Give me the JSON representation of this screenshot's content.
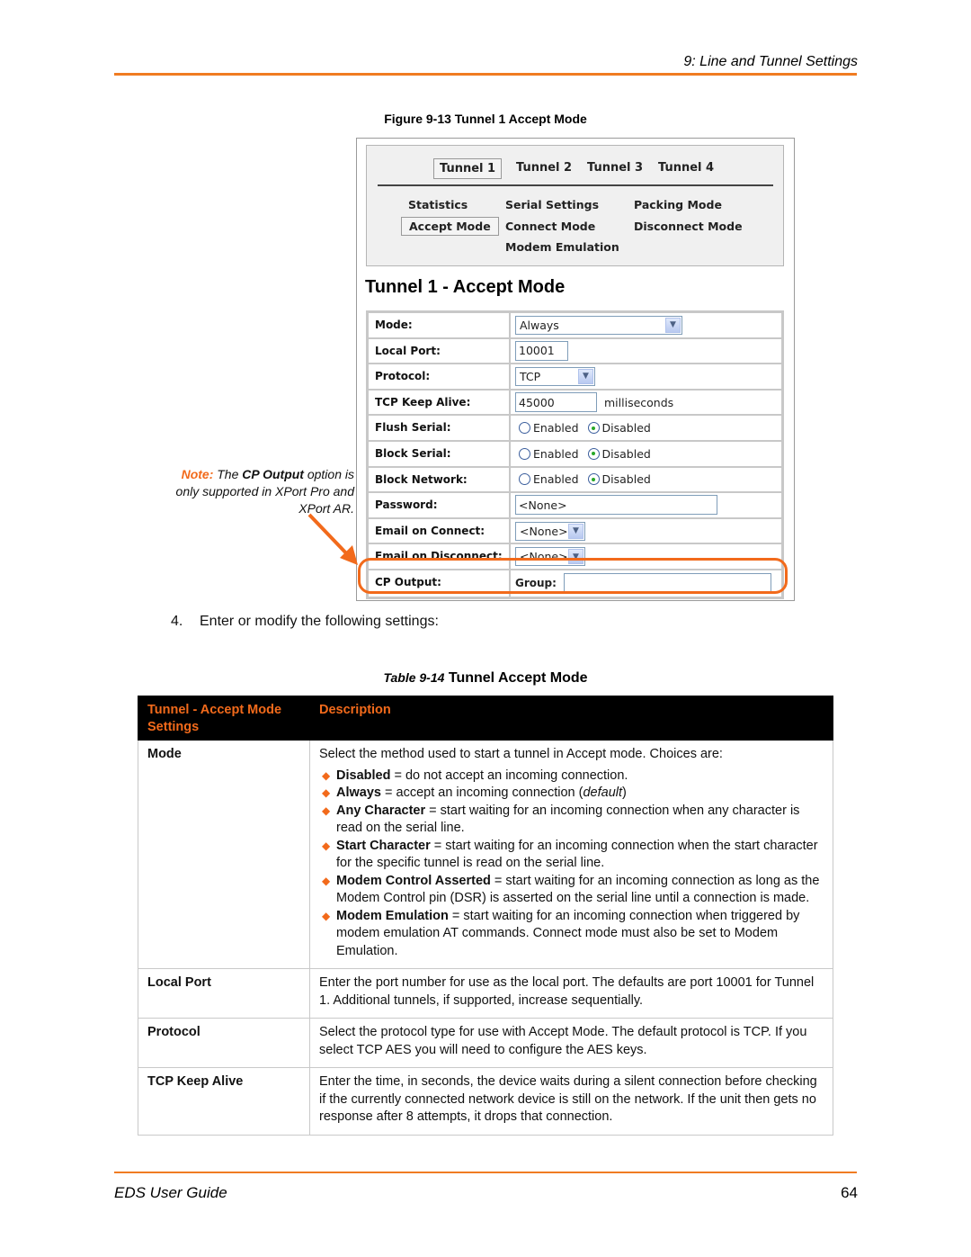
{
  "header": {
    "chapter_title": "9: Line and Tunnel Settings"
  },
  "figure": {
    "caption": "Figure 9-13  Tunnel 1 Accept Mode",
    "tabs": [
      {
        "label": "Tunnel 1",
        "active": true
      },
      {
        "label": "Tunnel 2",
        "active": false
      },
      {
        "label": "Tunnel 3",
        "active": false
      },
      {
        "label": "Tunnel 4",
        "active": false
      }
    ],
    "nav_links": [
      {
        "label": "Statistics",
        "active": false
      },
      {
        "label": "Serial Settings",
        "active": false
      },
      {
        "label": "Packing Mode",
        "active": false
      },
      {
        "label": "Accept Mode",
        "active": true
      },
      {
        "label": "Connect Mode",
        "active": false
      },
      {
        "label": "Disconnect Mode",
        "active": false
      },
      {
        "label": "Modem Emulation",
        "active": false
      }
    ],
    "page_heading": "Tunnel 1 - Accept Mode",
    "form": {
      "mode": {
        "label": "Mode:",
        "value": "Always"
      },
      "local_port": {
        "label": "Local Port:",
        "value": "10001"
      },
      "protocol": {
        "label": "Protocol:",
        "value": "TCP"
      },
      "tcp_keep_alive": {
        "label": "TCP Keep Alive:",
        "value": "45000",
        "unit": "milliseconds"
      },
      "flush_serial": {
        "label": "Flush Serial:",
        "options": [
          "Enabled",
          "Disabled"
        ],
        "selected": "Disabled"
      },
      "block_serial": {
        "label": "Block Serial:",
        "options": [
          "Enabled",
          "Disabled"
        ],
        "selected": "Disabled"
      },
      "block_network": {
        "label": "Block Network:",
        "options": [
          "Enabled",
          "Disabled"
        ],
        "selected": "Disabled"
      },
      "password": {
        "label": "Password:",
        "value": "<None>"
      },
      "email_on_connect": {
        "label": "Email on Connect:",
        "value": "<None>"
      },
      "email_on_disconnect": {
        "label": "Email on Disconnect:",
        "value": "<None>"
      },
      "cp_output": {
        "label": "CP Output:",
        "group_label": "Group:",
        "group_value": ""
      }
    },
    "note": {
      "label": "Note:",
      "pre": "The ",
      "bold": "CP Output",
      "post": " option is only supported in XPort Pro and XPort AR."
    },
    "accent_color": "#f26a1b"
  },
  "step": {
    "number": "4.",
    "text": "Enter or modify the following settings:"
  },
  "table": {
    "caption_prefix": "Table 9-14",
    "caption_title": " Tunnel Accept Mode",
    "headers": [
      "Tunnel -  Accept Mode Settings",
      "Description"
    ],
    "rows": [
      {
        "setting": "Mode",
        "intro": "Select the method used to start a tunnel in Accept mode. Choices are:",
        "bullets": [
          {
            "term": "Disabled",
            "text": " = do not accept an incoming connection."
          },
          {
            "term": "Always",
            "text": " = accept an incoming connection (",
            "em": "default",
            "after": ")"
          },
          {
            "term": "Any Character",
            "text": " = start waiting for an incoming connection when any character is read on the serial line."
          },
          {
            "term": "Start Character",
            "text": " = start waiting for an incoming connection when the start character for the specific tunnel is read on the serial line."
          },
          {
            "term": "Modem Control Asserted",
            "text": " = start waiting for an incoming connection as long as the Modem Control pin (DSR) is asserted on the serial line until a connection is made."
          },
          {
            "term": "Modem Emulation",
            "text": " = start waiting for an incoming connection when triggered by modem emulation AT commands. Connect mode must also be set to Modem Emulation."
          }
        ]
      },
      {
        "setting": "Local Port",
        "intro": "Enter the port number for use as the local port. The defaults are port 10001 for Tunnel 1.  Additional tunnels, if supported, increase sequentially."
      },
      {
        "setting": "Protocol",
        "intro": "Select the protocol type for use with Accept Mode. The default protocol is TCP. If you select TCP AES you will need to configure the AES keys."
      },
      {
        "setting": "TCP Keep Alive",
        "intro": "Enter the time, in seconds, the device waits during a silent connection before checking if the currently connected network device is still on the network. If the unit then gets no response after 8 attempts, it drops that connection."
      }
    ]
  },
  "footer": {
    "doc_title": "EDS User Guide",
    "page_number": "64"
  }
}
